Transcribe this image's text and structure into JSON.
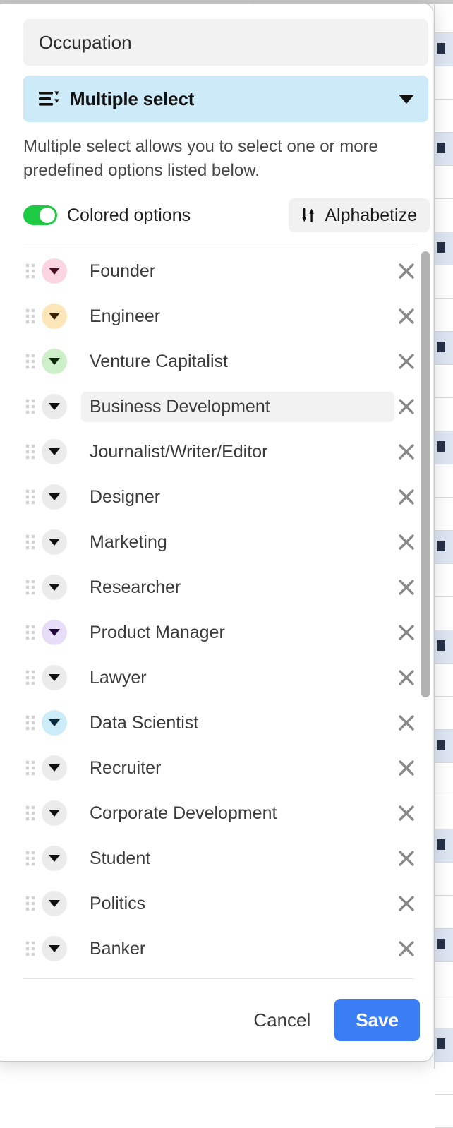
{
  "dialog": {
    "field_name": {
      "value": "Occupation",
      "placeholder": "Field name"
    },
    "type_selector": {
      "label": "Multiple select",
      "icon": "multiple-select-icon",
      "caret_icon": "chevron-down-icon",
      "background_color": "#cdeaf8"
    },
    "description": "Multiple select allows you to select one or more predefined options listed below.",
    "controls": {
      "toggle_label": "Colored options",
      "toggle_on": true,
      "toggle_on_color": "#1ccb41",
      "alphabetize_label": "Alphabetize",
      "alphabetize_icon": "sort-arrows-icon"
    },
    "options": [
      {
        "label": "Founder",
        "color": "#fbd5e2",
        "caret_color": "#4a0d23",
        "highlighted": false
      },
      {
        "label": "Engineer",
        "color": "#fde7ba",
        "caret_color": "#3d2200",
        "highlighted": false
      },
      {
        "label": "Venture Capitalist",
        "color": "#cdf0c9",
        "caret_color": "#0b2e08",
        "highlighted": false
      },
      {
        "label": "Business Development",
        "color": "#ebebeb",
        "caret_color": "#111111",
        "highlighted": true
      },
      {
        "label": "Journalist/Writer/Editor",
        "color": "#ebebeb",
        "caret_color": "#111111",
        "highlighted": false
      },
      {
        "label": "Designer",
        "color": "#ebebeb",
        "caret_color": "#111111",
        "highlighted": false
      },
      {
        "label": "Marketing",
        "color": "#ebebeb",
        "caret_color": "#111111",
        "highlighted": false
      },
      {
        "label": "Researcher",
        "color": "#ebebeb",
        "caret_color": "#111111",
        "highlighted": false
      },
      {
        "label": "Product Manager",
        "color": "#e8ddf8",
        "caret_color": "#26063f",
        "highlighted": false
      },
      {
        "label": "Lawyer",
        "color": "#ebebeb",
        "caret_color": "#111111",
        "highlighted": false
      },
      {
        "label": "Data Scientist",
        "color": "#cdecf9",
        "caret_color": "#062a3d",
        "highlighted": false
      },
      {
        "label": "Recruiter",
        "color": "#ebebeb",
        "caret_color": "#111111",
        "highlighted": false
      },
      {
        "label": "Corporate Development",
        "color": "#ebebeb",
        "caret_color": "#111111",
        "highlighted": false
      },
      {
        "label": "Student",
        "color": "#ebebeb",
        "caret_color": "#111111",
        "highlighted": false
      },
      {
        "label": "Politics",
        "color": "#ebebeb",
        "caret_color": "#111111",
        "highlighted": false
      },
      {
        "label": "Banker",
        "color": "#ebebeb",
        "caret_color": "#111111",
        "highlighted": false
      }
    ],
    "remove_icon": "close-icon",
    "drag_icon": "drag-handle-icon",
    "footer": {
      "cancel_label": "Cancel",
      "save_label": "Save",
      "save_color": "#3b7df5"
    }
  }
}
